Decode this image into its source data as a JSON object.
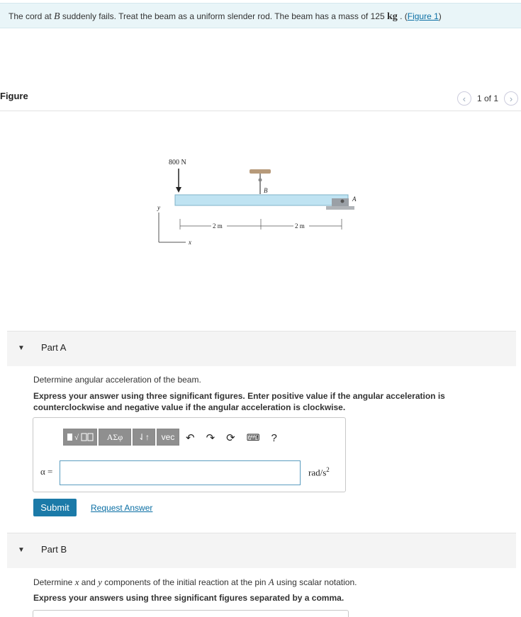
{
  "intro": {
    "text_before": "The cord at ",
    "var_b": "B",
    "text_mid": " suddenly fails. Treat the beam as a uniform slender rod. The beam has a mass of 125 ",
    "unit": "kg",
    "text_after": " . (",
    "figure_link": "Figure 1",
    "close_paren": ")"
  },
  "figure": {
    "heading": "Figure",
    "pager_text": "1 of 1",
    "load_label": "800 N",
    "point_b": "B",
    "point_a": "A",
    "dim_left": "2 m",
    "dim_right": "2 m",
    "axis_y": "y",
    "axis_x": "x",
    "beam_color": "#bfe3f2"
  },
  "part_a": {
    "title": "Part A",
    "question": "Determine angular acceleration of the beam.",
    "instructions": "Express your answer using three significant figures. Enter positive value if the angular acceleration is counterclockwise and negative value if the angular acceleration is clockwise.",
    "toolbar": {
      "templates_icon": "templates-icon",
      "greek_label": "ΑΣφ",
      "arrows_label": "⇃↑",
      "vec_label": "vec",
      "help_label": "?"
    },
    "answer_label": "α =",
    "answer_value": "",
    "unit_label": "rad/s",
    "unit_exp": "2",
    "submit_label": "Submit",
    "request_label": "Request Answer"
  },
  "part_b": {
    "title": "Part B",
    "q_before": "Determine ",
    "var_x": "x",
    "q_and": " and ",
    "var_y": "y",
    "q_mid": " components of the initial reaction at the pin ",
    "var_a": "A",
    "q_after": " using scalar notation.",
    "instructions": "Express your answers using three significant figures separated by a comma."
  },
  "colors": {
    "accent": "#1b7aa8",
    "intro_bg": "#e9f5f8"
  }
}
